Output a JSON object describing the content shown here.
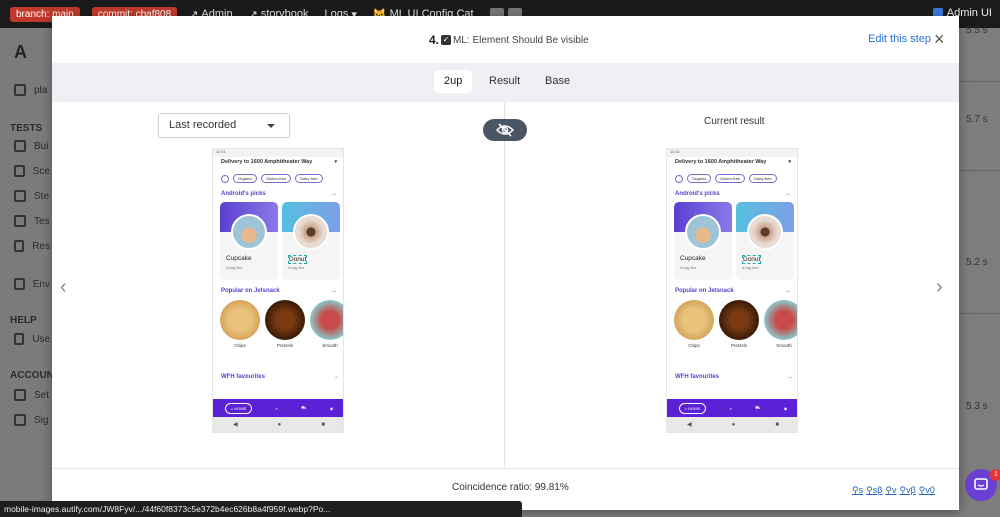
{
  "devbar": {
    "branch": "branch: main",
    "commit": "commit: cbaf808",
    "links": [
      "Admin",
      "storybook",
      "Logs",
      "ML UI Config Cat"
    ],
    "right_label": "Admin UI"
  },
  "background_app": {
    "logo": "A",
    "sidebar": {
      "top_item": "pla",
      "tests_section": "TESTS",
      "tests_items": [
        "Bui",
        "Sce",
        "Ste",
        "Tes",
        "Res"
      ],
      "env_item": "Env",
      "help_section": "HELP",
      "help_items": [
        "Use"
      ],
      "account_section": "ACCOUNT",
      "account_items": [
        "Set",
        "Sig"
      ]
    },
    "durations": [
      "5.5 s",
      "5.7 s",
      "5.2 s",
      "5.3 s"
    ]
  },
  "modal": {
    "step_number": "4.",
    "step_title": "ML: Element Should Be visible",
    "edit_link": "Edit this step",
    "close_icon": "×",
    "tabs": [
      {
        "label": "2up",
        "active": true
      },
      {
        "label": "Result",
        "active": false
      },
      {
        "label": "Base",
        "active": false
      }
    ],
    "left_select": {
      "value": "Last recorded"
    },
    "right_label": "Current result",
    "prev_arrow": "‹",
    "next_arrow": "›",
    "coincidence": "Coincidence ratio: 99.81%",
    "quick_links": [
      "s",
      "sβ",
      "v",
      "vβ",
      "v0"
    ]
  },
  "phone": {
    "status": "11:01",
    "address": "Delivery to 1600 Amphitheater Way",
    "filters": [
      "Organic",
      "Gluten-free",
      "Dairy-free"
    ],
    "section1": "Android's picks",
    "cards": [
      {
        "name": "Cupcake",
        "tag": "A tag line"
      },
      {
        "name": "Donut",
        "tag": "A tag line"
      }
    ],
    "section2": "Popular on Jetsnack",
    "snacks": [
      "Chips",
      "Pretzels",
      "Smooth"
    ],
    "section3": "WFH favourites",
    "home_label": "HOME",
    "arrow": "→"
  },
  "status_url": "mobile-images.autify.com/JW8Fyv/.../44f60f8373c5e372b4ec626b8a4f959f.webp?Po...",
  "colors": {
    "accent": "#1f6fd1",
    "brand_purple": "#5b21d6",
    "badge_red": "#c0392b"
  }
}
